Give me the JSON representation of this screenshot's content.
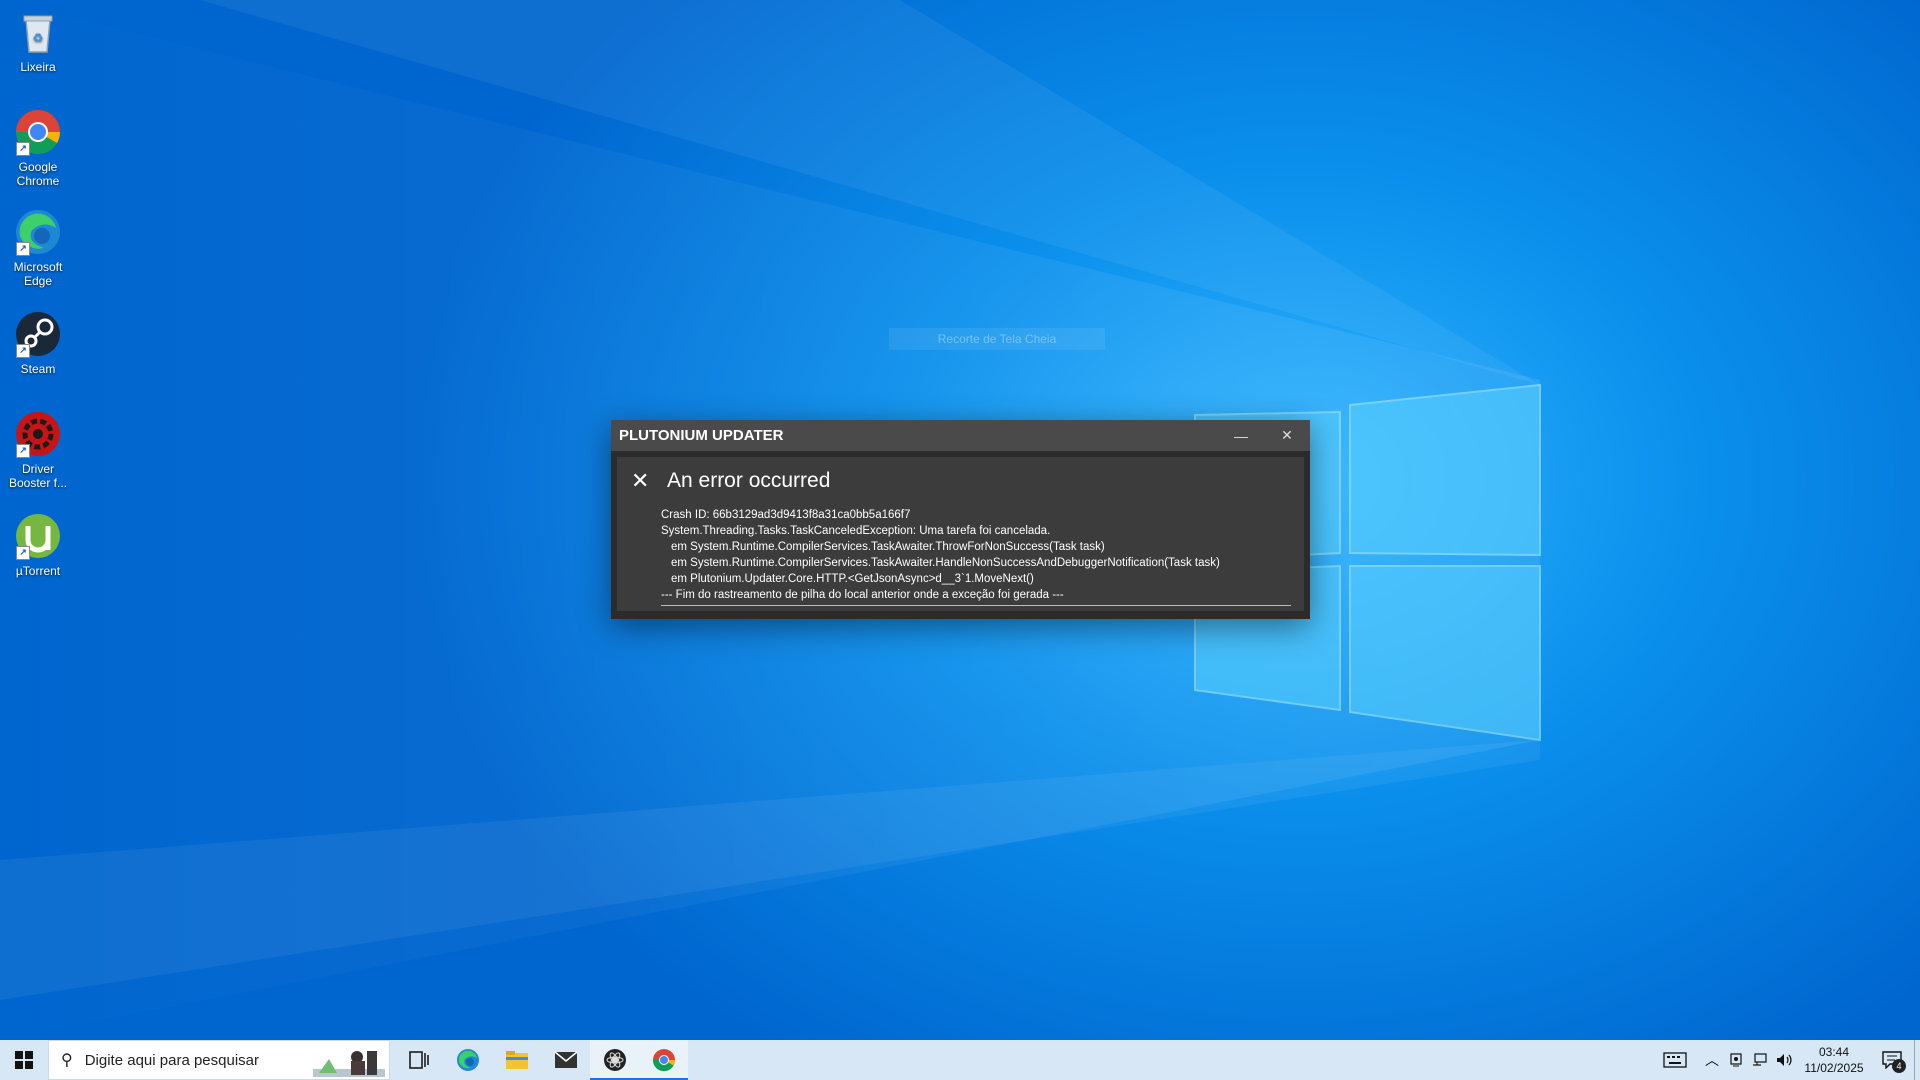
{
  "desktop": {
    "icons": [
      {
        "label": "Lixeira",
        "icon": "recycle-bin-icon"
      },
      {
        "label": "Google Chrome",
        "icon": "chrome-icon"
      },
      {
        "label": "Microsoft Edge",
        "icon": "edge-icon"
      },
      {
        "label": "Steam",
        "icon": "steam-icon"
      },
      {
        "label": "Driver Booster f...",
        "icon": "driver-booster-icon"
      },
      {
        "label": "µTorrent",
        "icon": "utorrent-icon"
      }
    ],
    "ghost_tooltip": "Recorte de Tela Cheia"
  },
  "dialog": {
    "title": "PLUTONIUM UPDATER",
    "minimize_glyph": "—",
    "close_glyph": "✕",
    "error_glyph": "✕",
    "error_title": "An error occurred",
    "trace_lines": [
      "Crash ID: 66b3129ad3d9413f8a31ca0bb5a166f7",
      "System.Threading.Tasks.TaskCanceledException: Uma tarefa foi cancelada.",
      "em System.Runtime.CompilerServices.TaskAwaiter.ThrowForNonSuccess(Task task)",
      "em System.Runtime.CompilerServices.TaskAwaiter.HandleNonSuccessAndDebuggerNotification(Task task)",
      "em Plutonium.Updater.Core.HTTP.<GetJsonAsync>d__3`1.MoveNext()",
      "--- Fim do rastreamento de pilha do local anterior onde a exceção foi gerada ---"
    ]
  },
  "taskbar": {
    "search_placeholder": "Digite aqui para pesquisar",
    "apps": [
      "task-view-icon",
      "edge-icon",
      "file-explorer-icon",
      "mail-icon",
      "plutonium-icon",
      "chrome-icon"
    ],
    "active_app": "chrome-icon",
    "clock_time": "03:44",
    "clock_date": "11/02/2025",
    "notification_count": "4"
  },
  "colors": {
    "desktop_blue": "#0a8fec",
    "dialog_bg": "#2b2b2b",
    "dialog_titlebar": "#4a4a4a",
    "error_panel": "#3c3c3c",
    "taskbar": "#d7e7f5"
  }
}
